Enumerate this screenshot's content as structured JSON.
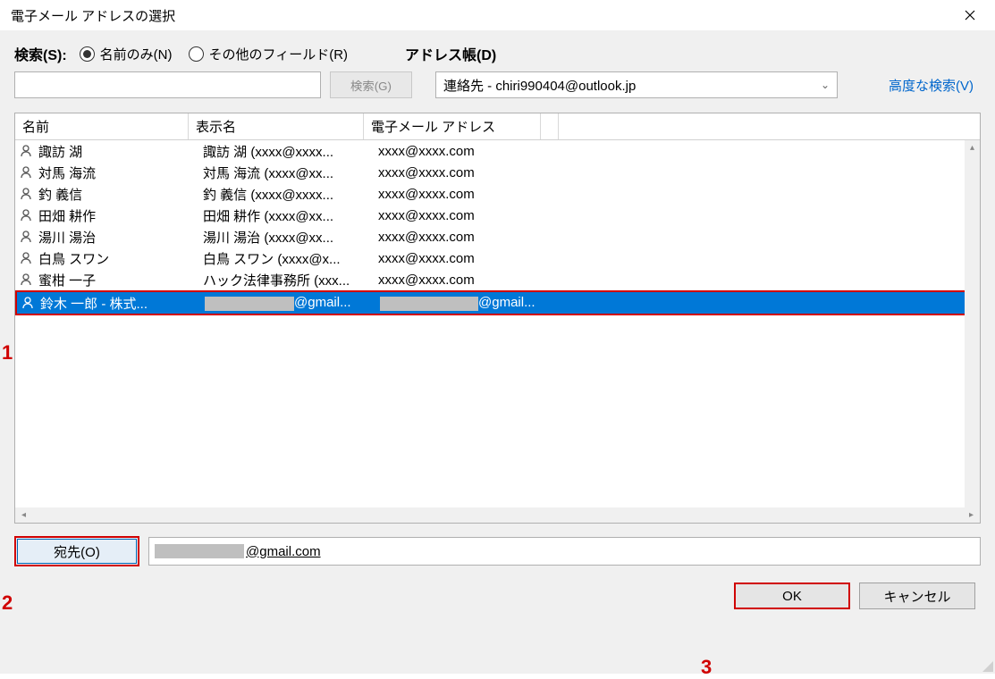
{
  "title": "電子メール アドレスの選択",
  "search": {
    "label": "検索(S):",
    "radio_name_only": "名前のみ(N)",
    "radio_other_fields": "その他のフィールド(R)",
    "button": "検索(G)",
    "advanced": "高度な検索(V)"
  },
  "address_book": {
    "label": "アドレス帳(D)",
    "selected": "連絡先 - chiri990404@outlook.jp"
  },
  "columns": {
    "name": "名前",
    "display": "表示名",
    "email": "電子メール アドレス"
  },
  "rows": [
    {
      "name": "諏訪 湖",
      "display": "諏訪 湖 (xxxx@xxxx...",
      "email": "xxxx@xxxx.com"
    },
    {
      "name": "対馬 海流",
      "display": "対馬 海流 (xxxx@xx...",
      "email": "xxxx@xxxx.com"
    },
    {
      "name": "釣 義信",
      "display": "釣 義信 (xxxx@xxxx...",
      "email": "xxxx@xxxx.com"
    },
    {
      "name": "田畑 耕作",
      "display": "田畑 耕作 (xxxx@xx...",
      "email": "xxxx@xxxx.com"
    },
    {
      "name": "湯川 湯治",
      "display": "湯川 湯治 (xxxx@xx...",
      "email": "xxxx@xxxx.com"
    },
    {
      "name": "白鳥 スワン",
      "display": "白鳥 スワン (xxxx@x...",
      "email": "xxxx@xxxx.com"
    },
    {
      "name": "蜜柑 一子",
      "display": "ハック法律事務所 (xxx...",
      "email": "xxxx@xxxx.com"
    }
  ],
  "selected_row": {
    "name": "鈴木 一郎 - 株式...",
    "display_suffix": "@gmail...",
    "email_suffix": "@gmail..."
  },
  "to": {
    "button": "宛先(O)",
    "suffix": "@gmail.com"
  },
  "buttons": {
    "ok": "OK",
    "cancel": "キャンセル"
  },
  "annotations": {
    "a1": "1",
    "a2": "2",
    "a3": "3"
  }
}
